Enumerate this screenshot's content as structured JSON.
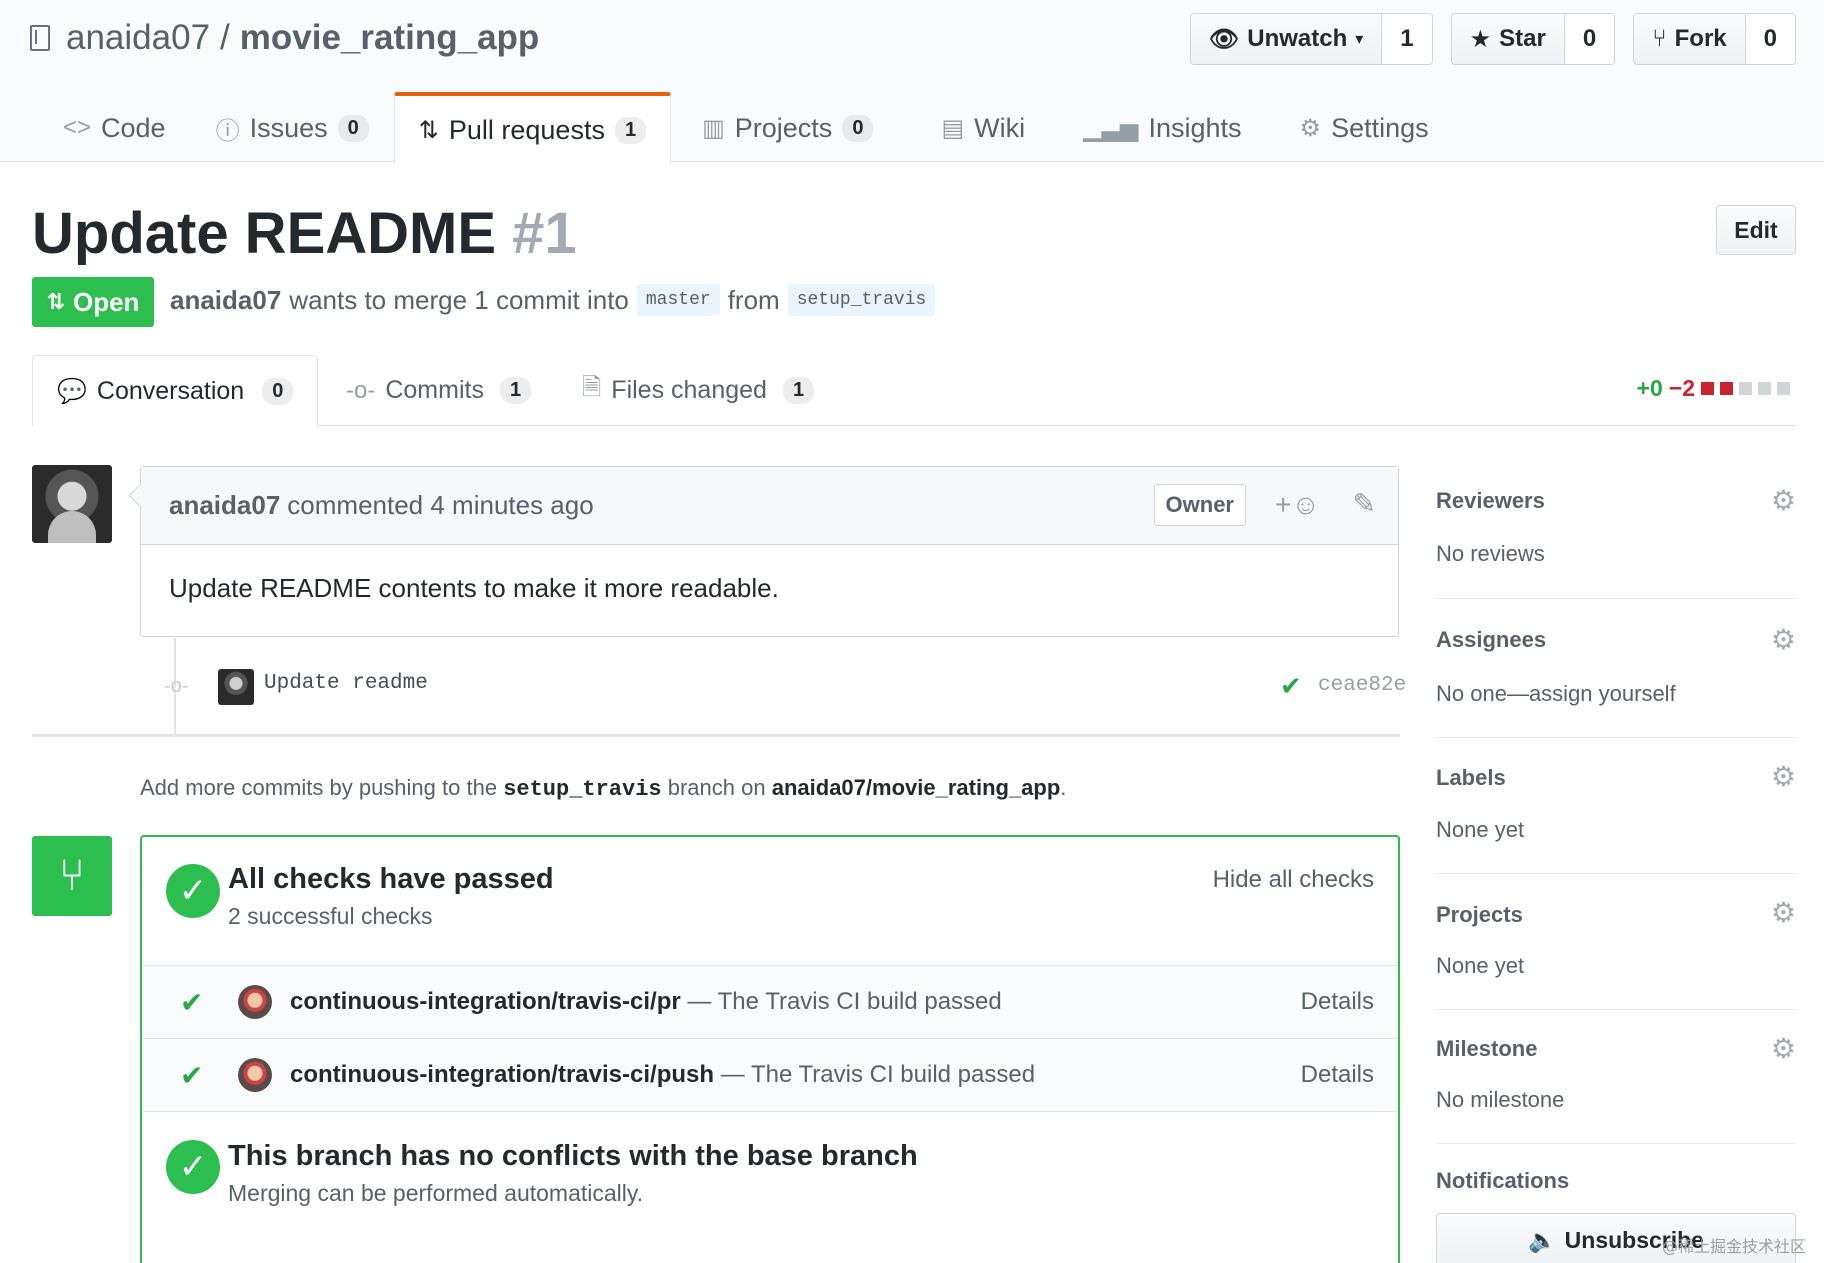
{
  "repo": {
    "owner": "anaida07",
    "separator": "/",
    "name": "movie_rating_app"
  },
  "actions": {
    "watch": {
      "label": "Unwatch",
      "count": "1"
    },
    "star": {
      "label": "Star",
      "count": "0"
    },
    "fork": {
      "label": "Fork",
      "count": "0"
    }
  },
  "reponav": [
    {
      "label": "Code"
    },
    {
      "label": "Issues",
      "count": "0"
    },
    {
      "label": "Pull requests",
      "count": "1"
    },
    {
      "label": "Projects",
      "count": "0"
    },
    {
      "label": "Wiki"
    },
    {
      "label": "Insights"
    },
    {
      "label": "Settings"
    }
  ],
  "pr": {
    "title": "Update README",
    "number": "#1",
    "edit_label": "Edit",
    "state": "Open",
    "author": "anaida07",
    "meta_text": "wants to merge 1 commit into",
    "base_branch": "master",
    "from_text": "from",
    "head_branch": "setup_travis"
  },
  "tabs": [
    {
      "label": "Conversation",
      "count": "0"
    },
    {
      "label": "Commits",
      "count": "1"
    },
    {
      "label": "Files changed",
      "count": "1"
    }
  ],
  "diffstat": {
    "additions": "+0",
    "deletions": "−2"
  },
  "comment": {
    "author": "anaida07",
    "action": "commented 4 minutes ago",
    "role": "Owner",
    "body": "Update README contents to make it more readable."
  },
  "commit": {
    "message": "Update readme",
    "sha": "ceae82e"
  },
  "push_help": {
    "prefix": "Add more commits by pushing to the",
    "branch": "setup_travis",
    "middle": "branch on",
    "repo": "anaida07/movie_rating_app",
    "suffix": "."
  },
  "merge": {
    "checks_title": "All checks have passed",
    "checks_sub": "2 successful checks",
    "hide_label": "Hide all checks",
    "checks": [
      {
        "name": "continuous-integration/travis-ci/pr",
        "desc": "— The Travis CI build passed",
        "details": "Details"
      },
      {
        "name": "continuous-integration/travis-ci/push",
        "desc": "— The Travis CI build passed",
        "details": "Details"
      }
    ],
    "conflict_title": "This branch has no conflicts with the base branch",
    "conflict_sub": "Merging can be performed automatically."
  },
  "sidebar": {
    "reviewers": {
      "heading": "Reviewers",
      "value": "No reviews"
    },
    "assignees": {
      "heading": "Assignees",
      "value": "No one—assign yourself"
    },
    "labels": {
      "heading": "Labels",
      "value": "None yet"
    },
    "projects": {
      "heading": "Projects",
      "value": "None yet"
    },
    "milestone": {
      "heading": "Milestone",
      "value": "No milestone"
    },
    "notifications": {
      "heading": "Notifications",
      "button": "Unsubscribe"
    }
  },
  "watermark": "@稀土掘金技术社区",
  "colors": {
    "open_green": "#2cbe4e",
    "tab_accent": "#e36209",
    "addition": "#28a745",
    "deletion": "#cb2431"
  }
}
